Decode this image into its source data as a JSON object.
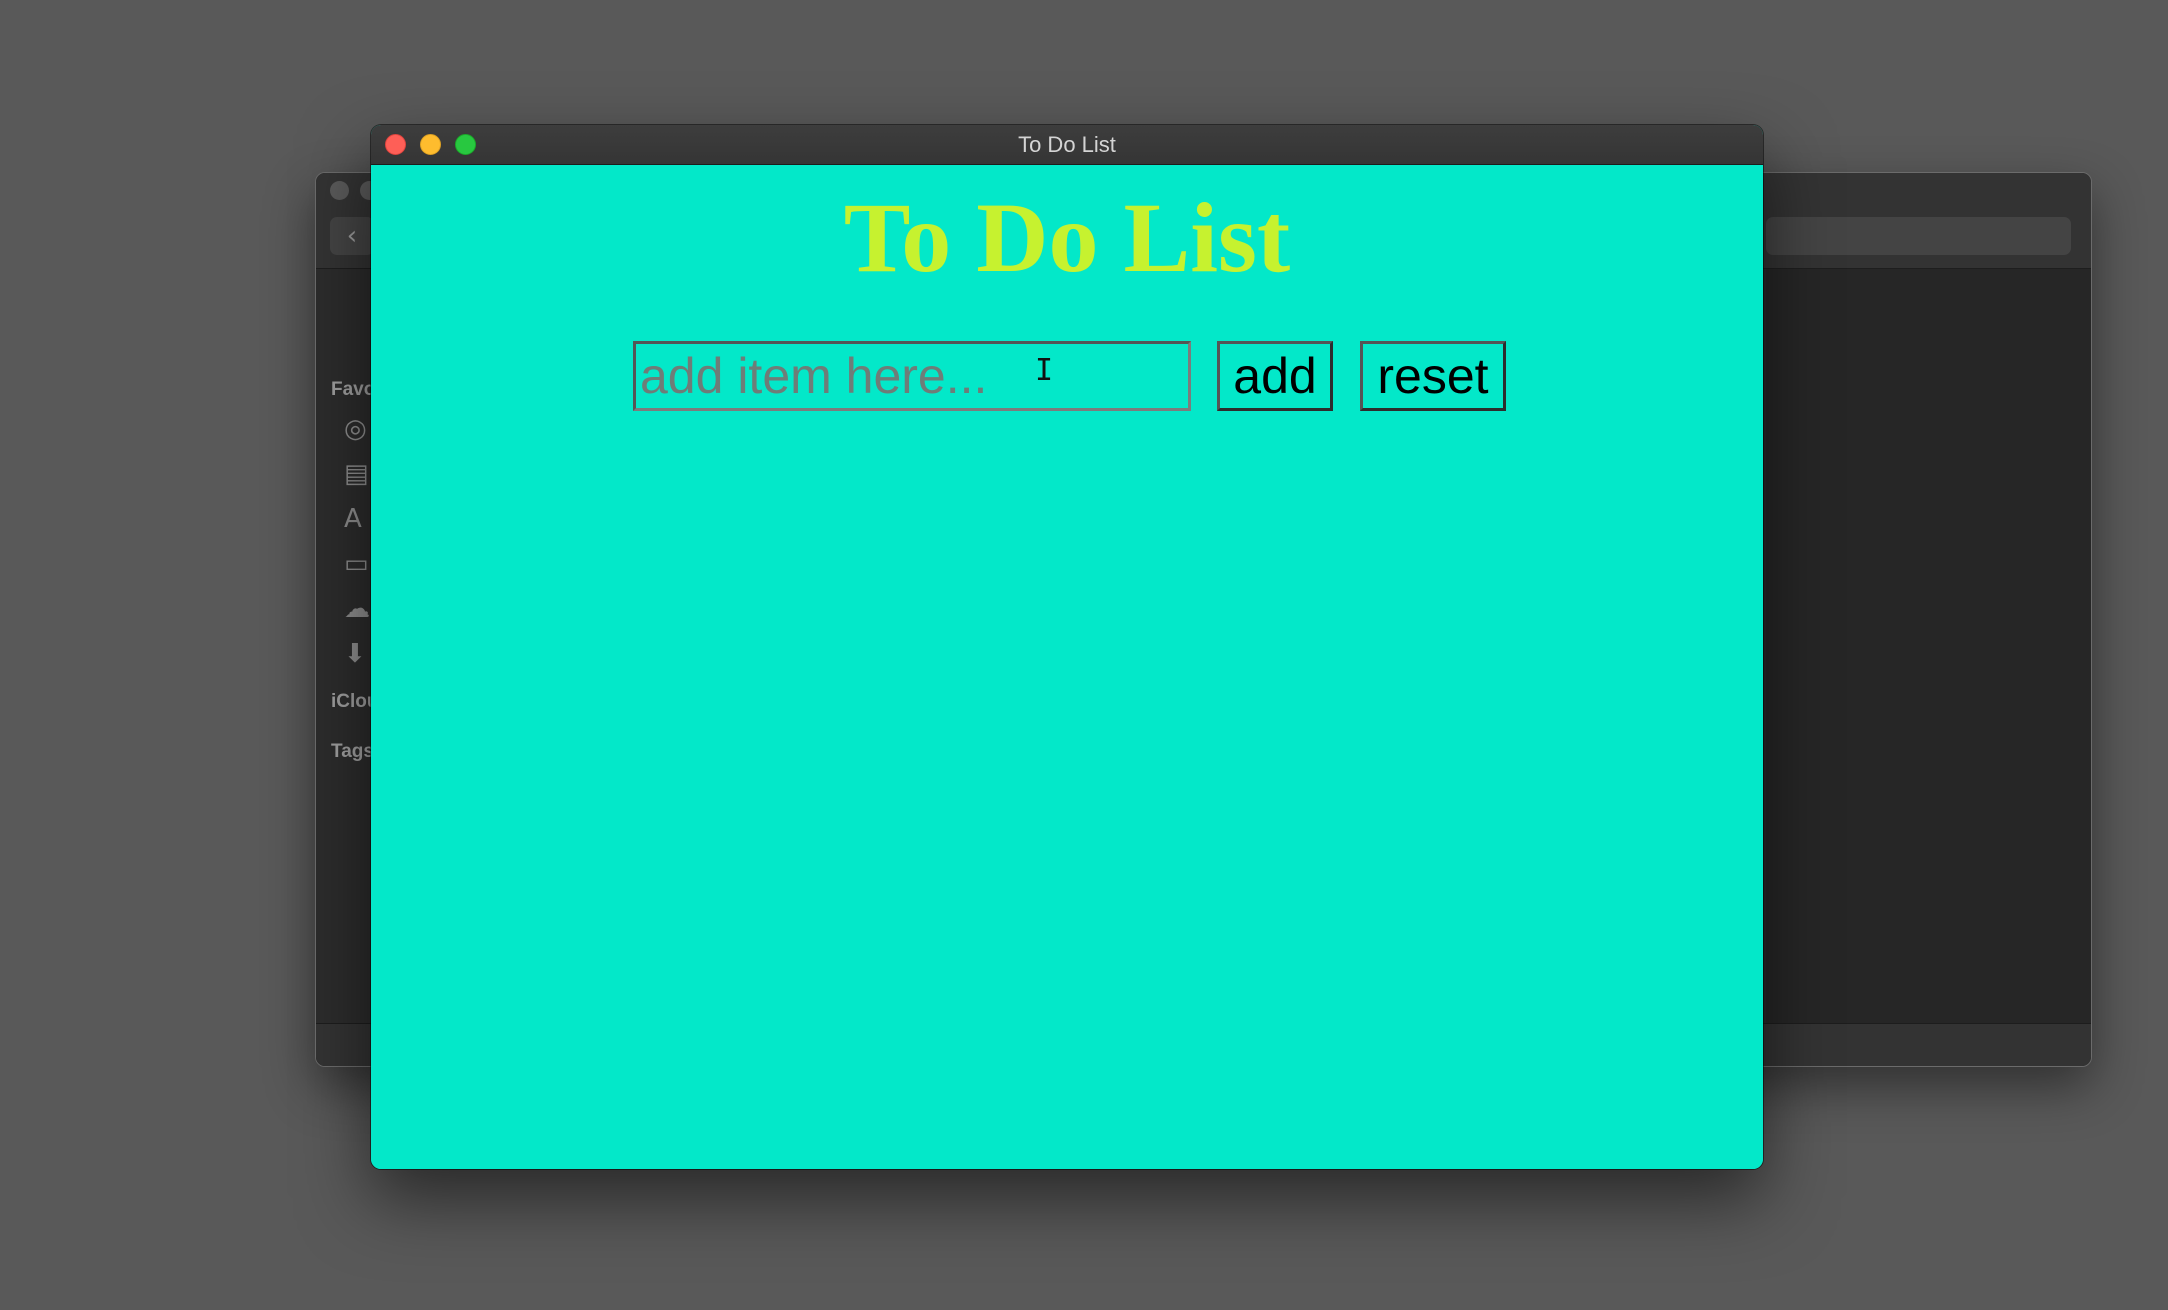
{
  "background_window": {
    "sidebar_sections": [
      "Favo",
      "iClou",
      "Tags"
    ],
    "sidebar_icons": [
      "airdrop-icon",
      "recents-icon",
      "applications-icon",
      "desktop-icon",
      "icloud-drive-icon",
      "downloads-icon"
    ],
    "back_glyph": "‹"
  },
  "window": {
    "title": "To Do List",
    "background_color": "#03e8c9"
  },
  "app": {
    "heading": "To Do List",
    "heading_color": "#c6f22f",
    "input_placeholder": "add item here...",
    "input_value": "",
    "add_label": "add",
    "reset_label": "reset"
  }
}
